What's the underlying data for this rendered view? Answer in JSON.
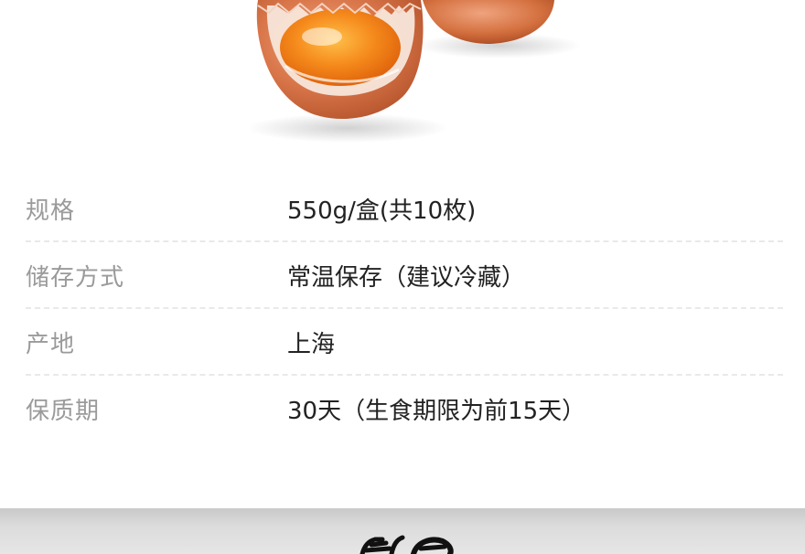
{
  "specs": [
    {
      "label": "规格",
      "value": "550g/盒(共10枚)"
    },
    {
      "label": "储存方式",
      "value": "常温保存（建议冷藏）"
    },
    {
      "label": "产地",
      "value": "上海"
    },
    {
      "label": "保质期",
      "value": "30天（生食期限为前15天）"
    }
  ],
  "colors": {
    "label": "#9a9a9a",
    "value": "#222222",
    "divider": "#e9e9e9",
    "eggshell": "#d9764a",
    "yolk": "#f58a1c",
    "band": "#d6d6d6"
  },
  "icons": {
    "hero": "cracked-egg-image",
    "band": "brush-calligraphy-fragment"
  }
}
